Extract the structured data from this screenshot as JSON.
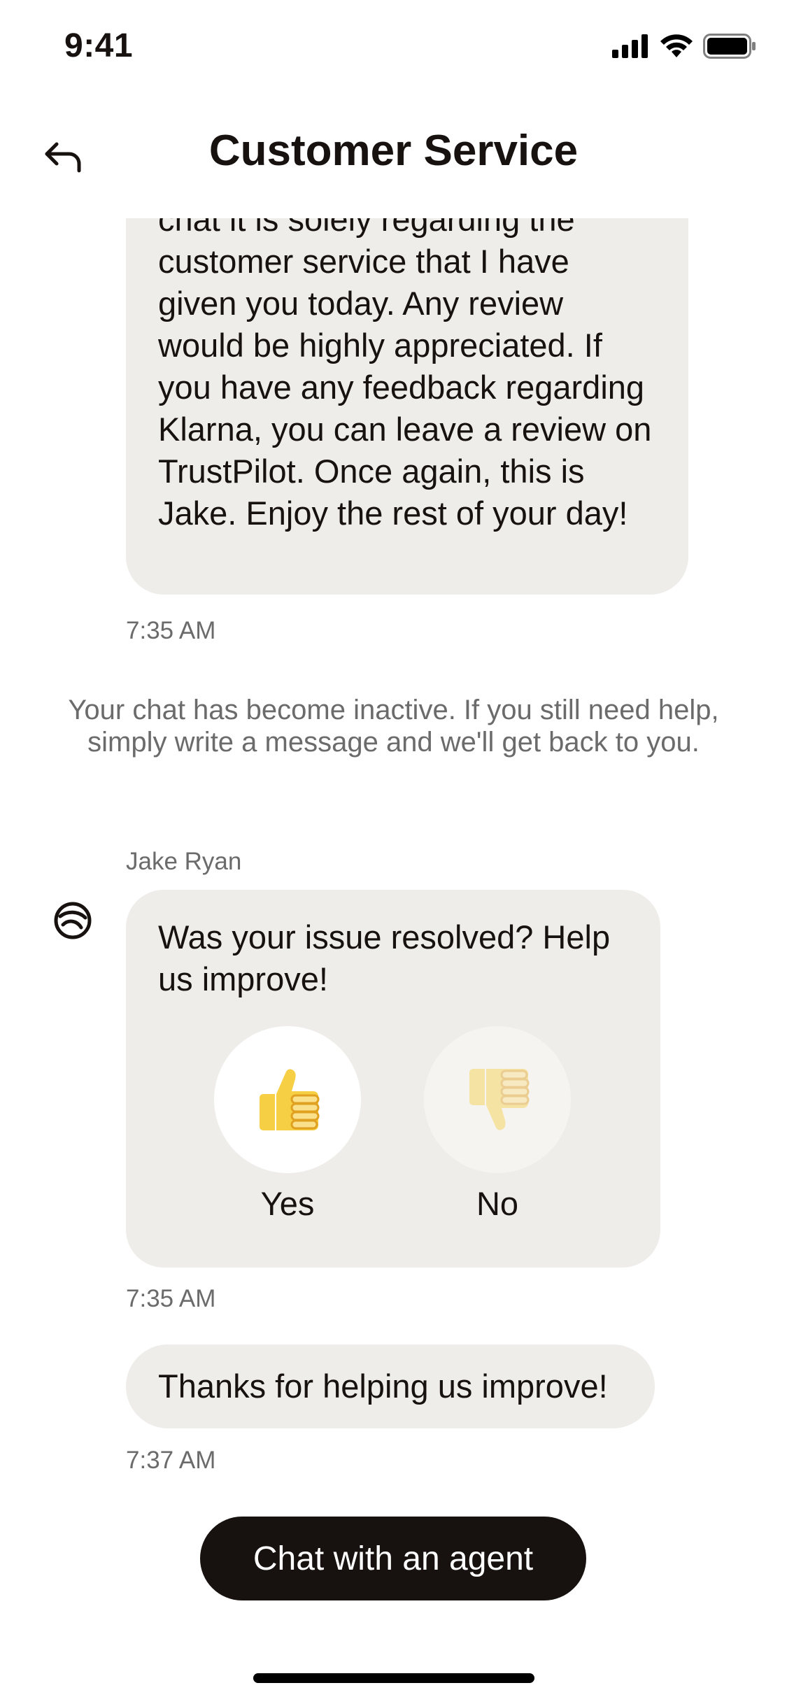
{
  "status_bar": {
    "time": "9:41"
  },
  "header": {
    "title": "Customer Service"
  },
  "messages": {
    "first": {
      "text": "chat it is solely regarding the customer service that I have given you today. Any review would be highly appreciated. If you have any feedback regarding Klarna, you can leave a review on TrustPilot. Once again, this is Jake. Enjoy the rest of your day!",
      "time": "7:35 AM"
    },
    "system_note": "Your chat has become inactive. If you still need help, simply write a message and we'll get back to you.",
    "agent_name": "Jake Ryan",
    "feedback": {
      "question": "Was your issue resolved? Help us improve!",
      "yes_label": "Yes",
      "no_label": "No",
      "time": "7:35 AM"
    },
    "thanks": {
      "text": "Thanks for helping us improve!",
      "time": "7:37 AM"
    }
  },
  "cta": {
    "label": "Chat with an agent"
  },
  "colors": {
    "bubble": "#eeedea",
    "text": "#17120f",
    "muted": "#6b6b6b",
    "cta_bg": "#17120f",
    "thumb_yellow": "#f7cf45"
  }
}
